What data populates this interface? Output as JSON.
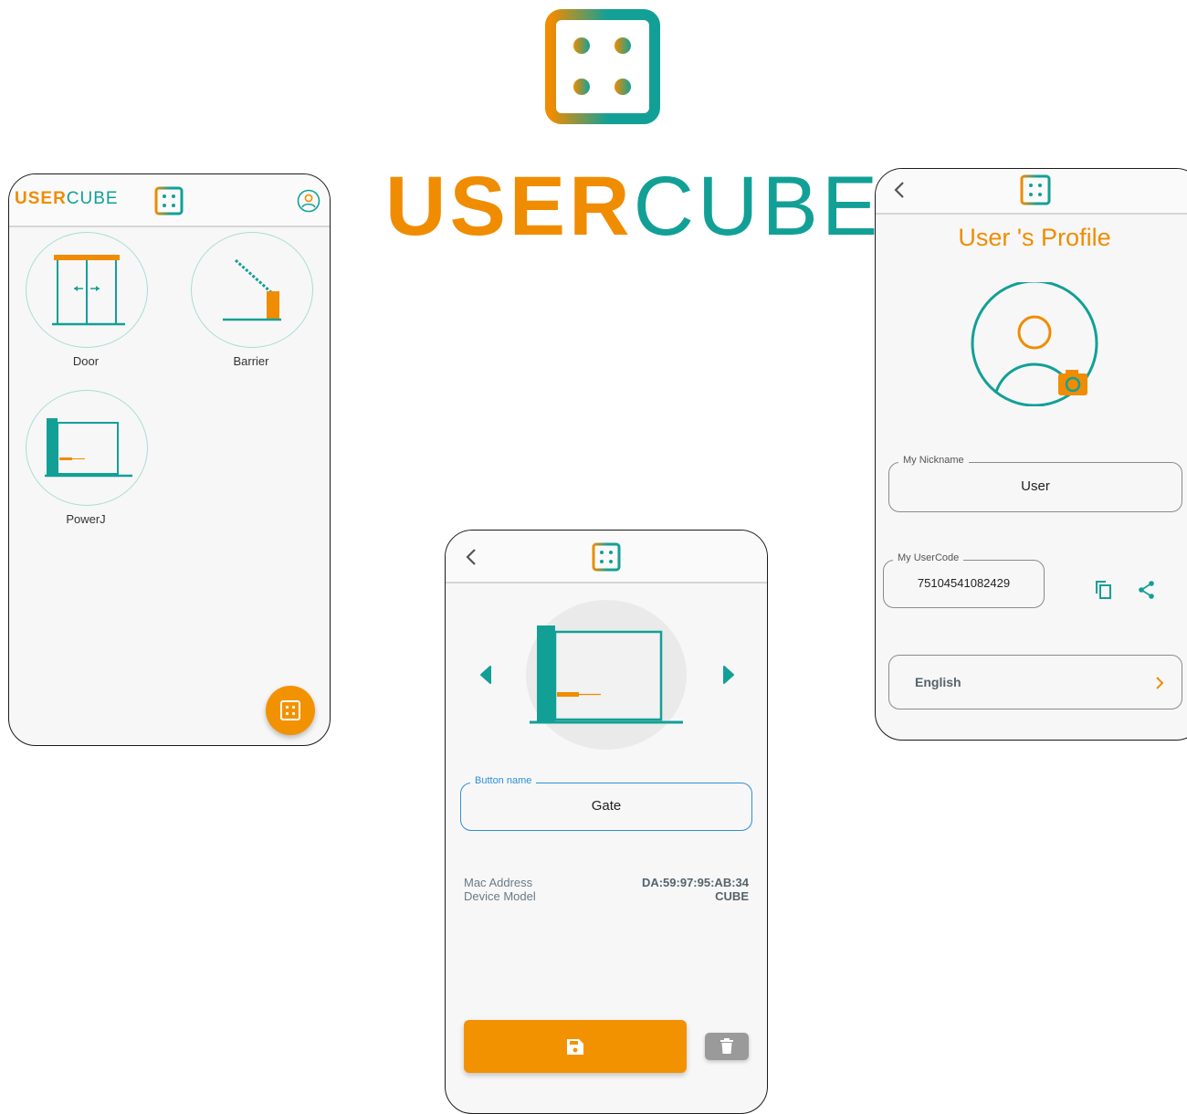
{
  "brand": {
    "name_orange": "USER",
    "name_teal": "CUBE"
  },
  "colors": {
    "accent_orange": "#f08c00",
    "accent_teal": "#12a096",
    "field_blue": "#2f8fd8"
  },
  "home_screen": {
    "logo_orange": "USER",
    "logo_teal": "CUBE",
    "header_icon": "cube-logo-icon",
    "profile_icon": "account-icon",
    "devices": [
      {
        "label": "Door",
        "icon": "sliding-door-icon"
      },
      {
        "label": "Barrier",
        "icon": "barrier-icon"
      },
      {
        "label": "PowerJ",
        "icon": "gate-icon"
      }
    ],
    "fab_icon": "cube-logo-icon"
  },
  "edit_screen": {
    "back_icon": "chevron-left-icon",
    "prev_icon": "arrow-left-icon",
    "next_icon": "arrow-right-icon",
    "field_label": "Button name",
    "field_value": "Gate",
    "mac_label": "Mac Address",
    "mac_value": "DA:59:97:95:AB:34",
    "model_label": "Device Model",
    "model_value": "CUBE",
    "save_icon": "save-icon",
    "delete_icon": "trash-icon"
  },
  "profile_screen": {
    "back_icon": "chevron-left-icon",
    "title": "User 's Profile",
    "avatar_icon": "avatar-icon",
    "camera_icon": "camera-icon",
    "nickname_label": "My Nickname",
    "nickname_value": "User",
    "usercode_label": "My UserCode",
    "usercode_value": "75104541082429",
    "copy_icon": "copy-icon",
    "share_icon": "share-icon",
    "language_value": "English",
    "language_chevron": "chevron-right-icon"
  }
}
